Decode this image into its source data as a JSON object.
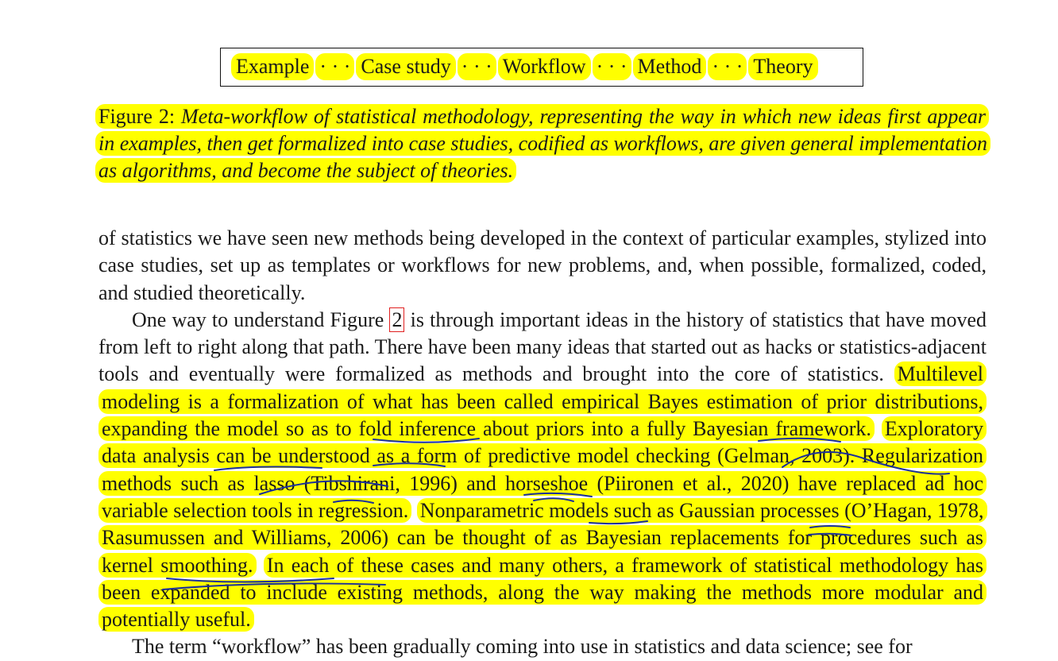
{
  "workflow": {
    "steps": [
      "Example",
      "Case study",
      "Workflow",
      "Method",
      "Theory"
    ],
    "separator": "· · ·"
  },
  "caption": {
    "label": "Figure 2:",
    "text": "Meta-workflow of statistical methodology, representing the way in which new ideas first appear in examples, then get formalized into case studies, codified as workflows, are given general implementation as algorithms, and become the subject of theories."
  },
  "body": {
    "p1": "of statistics we have seen new methods being developed in the context of particular examples, stylized into case studies, set up as templates or workflows for new problems, and, when possible, formalized, coded, and studied theoretically.",
    "p2_start": "One way to understand Figure",
    "p2_ref": "2",
    "p2_mid": "is through important ideas in the history of statistics that have moved from left to right along that path. There have been many ideas that started out as hacks or statistics-adjacent tools and eventually were formalized as methods and brought into the core of statistics.",
    "p2_h1": "Multilevel modeling is a formalization of what has been called empirical Bayes estimation of prior distributions, expanding the model so as to fold inference about priors into a fully Bayesian framework.",
    "p2_h2": "Exploratory data analysis can be understood as a form of predictive model checking (Gelman, 2003). Regularization methods such as lasso (Tibshirani, 1996) and horseshoe (Piironen et al., 2020) have replaced ad hoc variable selection tools in regression.",
    "p2_h3": "Nonparametric models such as Gaussian processes (O’Hagan, 1978, Rasumussen and Williams, 2006) can be thought of as Bayesian replacements for procedures such as kernel smoothing.",
    "p2_h4": "In each of these cases and many others, a framework of statistical methodology has been expanded to include existing methods, along the way making the methods more modular and potentially useful.",
    "p3": "The term “workflow” has been gradually coming into use in statistics and data science; see for"
  },
  "colors": {
    "highlight": "#ffff00",
    "ink": "#1a2f9a",
    "ref_box": "#e02020"
  }
}
